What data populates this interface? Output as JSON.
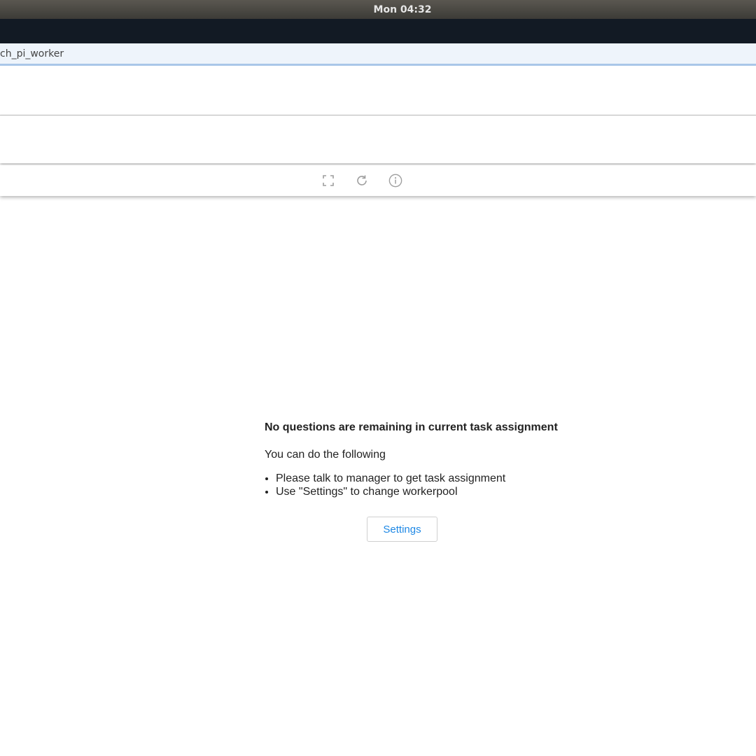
{
  "os": {
    "clock": "Mon 04:32"
  },
  "browser": {
    "url": "ch_pi_worker"
  },
  "toolbar": {
    "icons": [
      "fullscreen-icon",
      "refresh-icon",
      "info-icon"
    ]
  },
  "message": {
    "title": "No questions are remaining in current task assignment",
    "subtitle": "You can do the following",
    "items": [
      "Please talk to manager to get task assignment",
      "Use \"Settings\" to change workerpool"
    ]
  },
  "actions": {
    "settings_label": "Settings"
  },
  "colors": {
    "accent": "#1e88e5",
    "os_bar": "#3c3b37",
    "browser_strip": "#121a24",
    "url_bar": "#eef4fb"
  }
}
